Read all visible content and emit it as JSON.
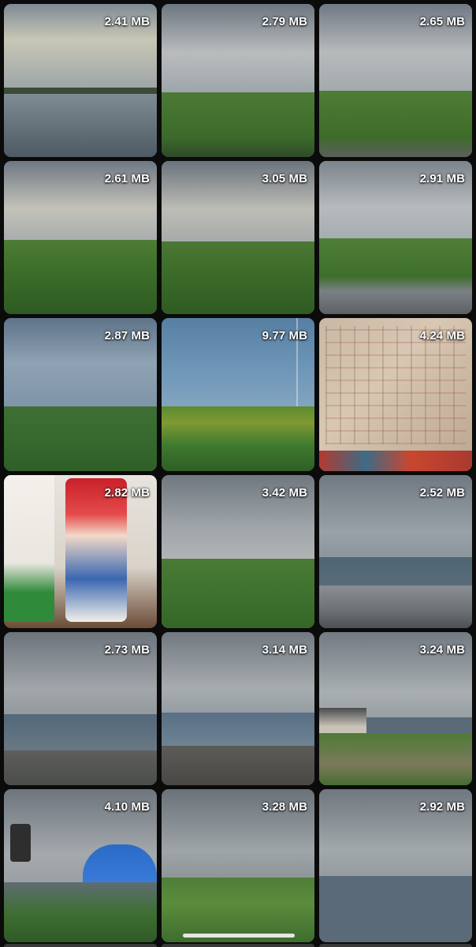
{
  "photos": [
    {
      "size": "2.41 MB"
    },
    {
      "size": "2.79 MB"
    },
    {
      "size": "2.65 MB"
    },
    {
      "size": "2.61 MB"
    },
    {
      "size": "3.05 MB"
    },
    {
      "size": "2.91 MB"
    },
    {
      "size": "2.87 MB"
    },
    {
      "size": "9.77 MB"
    },
    {
      "size": "4.24 MB"
    },
    {
      "size": "2.82 MB"
    },
    {
      "size": "3.42 MB"
    },
    {
      "size": "2.52 MB"
    },
    {
      "size": "2.73 MB"
    },
    {
      "size": "3.14 MB"
    },
    {
      "size": "3.24 MB"
    },
    {
      "size": "4.10 MB"
    },
    {
      "size": "3.28 MB"
    },
    {
      "size": "2.92 MB"
    }
  ],
  "colors": {
    "background": "#0b0b0b",
    "size_label": "#ffffff",
    "home_indicator": "#e6e6e6"
  }
}
